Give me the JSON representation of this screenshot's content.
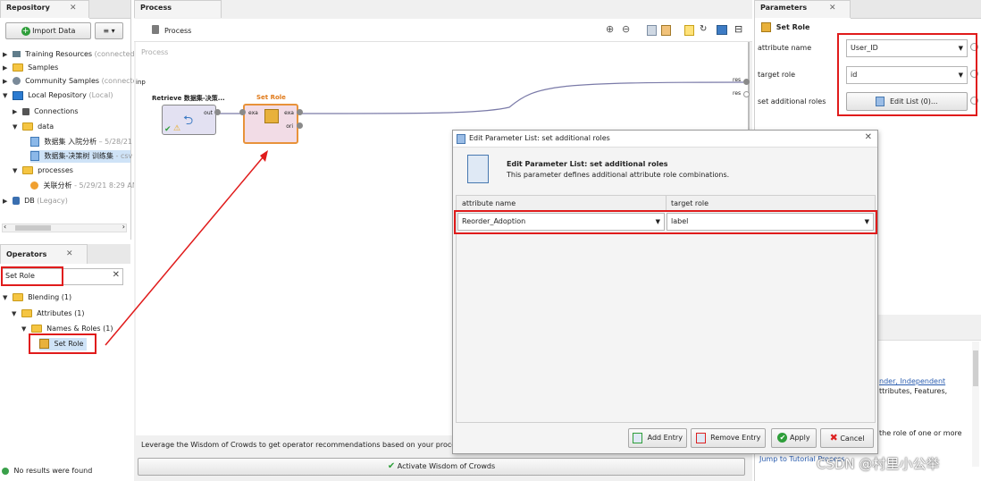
{
  "repository": {
    "tab_title": "Repository",
    "import_label": "Import Data",
    "menu_label": "≡ ▾",
    "items": [
      {
        "label": "Training Resources",
        "note": "(connected)"
      },
      {
        "label": "Samples",
        "note": ""
      },
      {
        "label": "Community Samples",
        "note": "(connected"
      },
      {
        "label": "Local Repository",
        "note": "(Local)"
      },
      {
        "label": "Connections",
        "note": ""
      },
      {
        "label": "data",
        "note": ""
      },
      {
        "label": "数据集 入院分析",
        "note": "– 5/28/21"
      },
      {
        "label": "数据集-决策树 训练集",
        "note": "- csv"
      },
      {
        "label": "processes",
        "note": ""
      },
      {
        "label": "关联分析",
        "note": "- 5/29/21 8:29 AM"
      },
      {
        "label": "DB",
        "note": "(Legacy)"
      }
    ]
  },
  "operators": {
    "tab_title": "Operators",
    "search_value": "Set Role",
    "tree": [
      {
        "label": "Blending (1)"
      },
      {
        "label": "Attributes (1)"
      },
      {
        "label": "Names & Roles (1)"
      },
      {
        "label": "Set Role"
      }
    ],
    "footer": "No results were found"
  },
  "process": {
    "tab_title": "Process",
    "breadcrumb": "Process",
    "canvas_label": "Process",
    "inp_label": "inp",
    "res_label_1": "res",
    "res_label_2": "res",
    "op1_title": "Retrieve 数据集-决策...",
    "op1_port": "out",
    "op2_title": "Set Role",
    "op2_port_in": "exa",
    "op2_port_out": "exa",
    "op2_port_ori": "ori",
    "wisdom_text": "Leverage the Wisdom of Crowds to get operator recommendations based on your process des",
    "wisdom_button": "Activate Wisdom of Crowds"
  },
  "parameters": {
    "tab_title": "Parameters",
    "operator_name": "Set Role",
    "attribute_name_label": "attribute name",
    "attribute_name_value": "User_ID",
    "target_role_label": "target role",
    "target_role_value": "id",
    "set_additional_label": "set additional roles",
    "edit_list_label": "Edit List (0)...",
    "help_text_1": "nder, Independent",
    "help_text_2": "ttributes, Features,",
    "help_text_3": "the role of one or more",
    "help_link": "Jump to Tutorial Process"
  },
  "dialog": {
    "title": "Edit Parameter List: set additional roles",
    "heading": "Edit Parameter List: set additional roles",
    "description": "This parameter defines additional attribute role combinations.",
    "col_attribute": "attribute name",
    "col_target": "target role",
    "row_attribute": "Reorder_Adoption",
    "row_target": "label",
    "add_entry": "Add Entry",
    "remove_entry": "Remove Entry",
    "apply": "Apply",
    "cancel": "Cancel"
  },
  "watermark": "CSDN @村里小公举"
}
